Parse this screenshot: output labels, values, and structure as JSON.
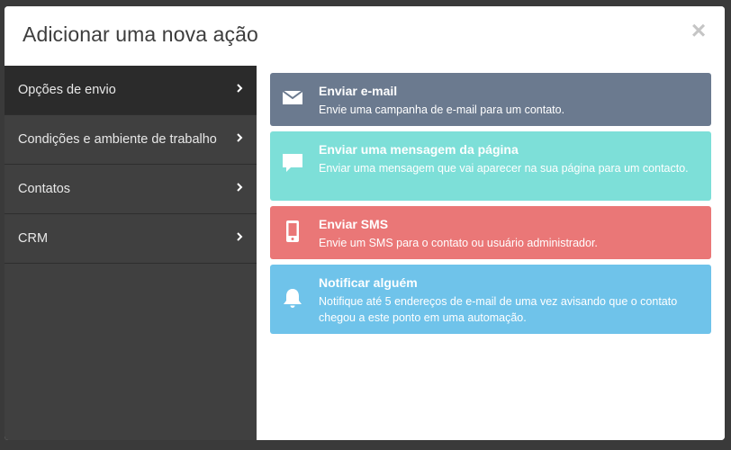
{
  "modal": {
    "title": "Adicionar uma nova ação",
    "close_label": "×"
  },
  "sidebar": {
    "items": [
      {
        "label": "Opções de envio",
        "active": true
      },
      {
        "label": "Condições e ambiente de trabalho",
        "active": false
      },
      {
        "label": "Contatos",
        "active": false
      },
      {
        "label": "CRM",
        "active": false
      }
    ]
  },
  "actions": [
    {
      "title": "Enviar e-mail",
      "description": "Envie uma campanha de e-mail para um contato.",
      "icon": "envelope-icon",
      "color": "#6b7a8f"
    },
    {
      "title": "Enviar uma mensagem da página",
      "description": "Enviar uma mensagem que vai aparecer na sua página para um contacto.",
      "icon": "chat-bubble-icon",
      "color": "#7ddfd8"
    },
    {
      "title": "Enviar SMS",
      "description": "Envie um SMS para o contato ou usuário administrador.",
      "icon": "mobile-phone-icon",
      "color": "#ea7777"
    },
    {
      "title": "Notificar alguém",
      "description": "Notifique até 5 endereços de e-mail de uma vez avisando que o contato chegou a este ponto em uma automação.",
      "icon": "bell-icon",
      "color": "#6fc3ea"
    }
  ]
}
